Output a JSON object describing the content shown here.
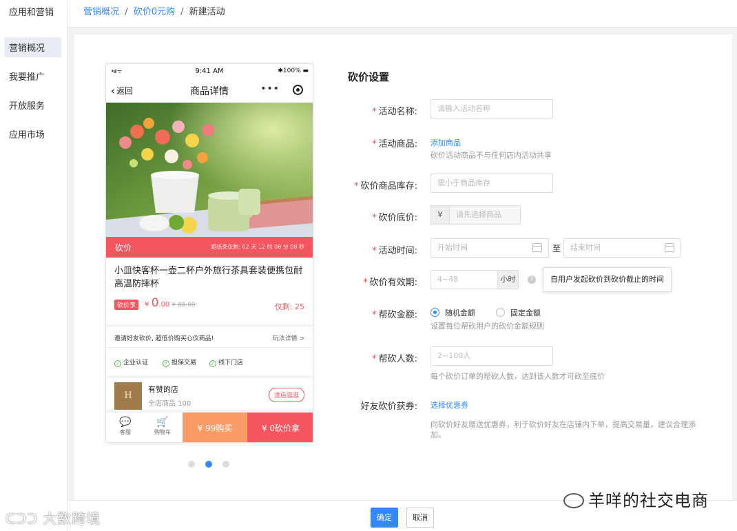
{
  "sidebar": {
    "app_title": "应用和营销",
    "items": [
      {
        "label": "营销概况",
        "active": true
      },
      {
        "label": "我要推广",
        "active": false
      },
      {
        "label": "开放服务",
        "active": false
      },
      {
        "label": "应用市场",
        "active": false
      }
    ]
  },
  "breadcrumb": {
    "items": [
      "营销概况",
      "砍价0元购"
    ],
    "separator": "/",
    "current": "新建活动"
  },
  "phone": {
    "status": {
      "signal": "•ııl ᯤ",
      "time": "9:41 AM",
      "battery": "✱100% ▬"
    },
    "nav": {
      "back": "返回",
      "title": "商品详情",
      "more": "•••"
    },
    "kanjia_label": "砍价",
    "countdown": "距结束仅剩: 02 天 12 时 08 分 08 秒",
    "product_name": "小皿快客杯一壶二杯户外旅行茶具套装便携包耐高温防摔杯",
    "tag": "砍价享",
    "price_currency": "¥",
    "price_big": "0",
    "price_decimal": ".00",
    "orig_price": "¥ 88.00",
    "remain": "仅剩: 25",
    "invite_text": "邀请好友砍价, 超低价购买心仪商品!",
    "rule_link": "玩法详情 >",
    "badges": [
      "企业认证",
      "担保交易",
      "线下门店"
    ],
    "shop_logo": "H",
    "shop_name": "有赞的店",
    "shop_count": "全店商品 100",
    "enter_shop": "进店逛逛",
    "icons": [
      {
        "label": "客服",
        "icon": "chat-icon"
      },
      {
        "label": "购物车",
        "icon": "cart-icon"
      }
    ],
    "buy_label": "¥ 99购买",
    "bargain_label": "¥ 0砍价拿"
  },
  "carousel": {
    "count": 3,
    "active": 1
  },
  "form": {
    "section_title": "砍价设置",
    "activity_name": {
      "label": "活动名称:",
      "placeholder": "请输入活动名称"
    },
    "activity_goods": {
      "label": "活动商品:",
      "link": "添加商品",
      "hint": "砍价活动商品不与任何店内活动共享"
    },
    "stock": {
      "label": "砍价商品库存:",
      "placeholder": "需小于商品库存"
    },
    "floor_price": {
      "label": "砍价底价:",
      "addon": "¥",
      "placeholder": "请先选择商品"
    },
    "activity_time": {
      "label": "活动时间:",
      "start": "开始时间",
      "to": "至",
      "end": "结束时间"
    },
    "validity": {
      "label": "砍价有效期:",
      "placeholder": "4~48",
      "unit": "小时",
      "help": "?",
      "tooltip": "自用户发起砍价到砍价截止的时间"
    },
    "help_amount": {
      "label": "帮砍金额:",
      "options": [
        "随机金额",
        "固定金额"
      ],
      "selected": 0,
      "hint": "设置每位帮砍用户的砍价金额规则"
    },
    "help_count": {
      "label": "帮砍人数:",
      "placeholder": "2~100人",
      "hint": "每个砍价订单的帮砍人数，达到该人数才可砍至底价"
    },
    "coupon": {
      "label": "好友砍价获券:",
      "link": "选择优惠券",
      "hint": "向砍价好友赠送优惠券，利于砍价好友在店铺内下单，提高交易量，建议合理添加。"
    }
  },
  "footer": {
    "confirm": "确定",
    "cancel": "取消"
  },
  "watermarks": {
    "left": "大数跨境",
    "right": "羊咩的社交电商"
  },
  "colors": {
    "accent": "#3388ff",
    "danger": "#f4555e",
    "buy": "#f89b66"
  }
}
